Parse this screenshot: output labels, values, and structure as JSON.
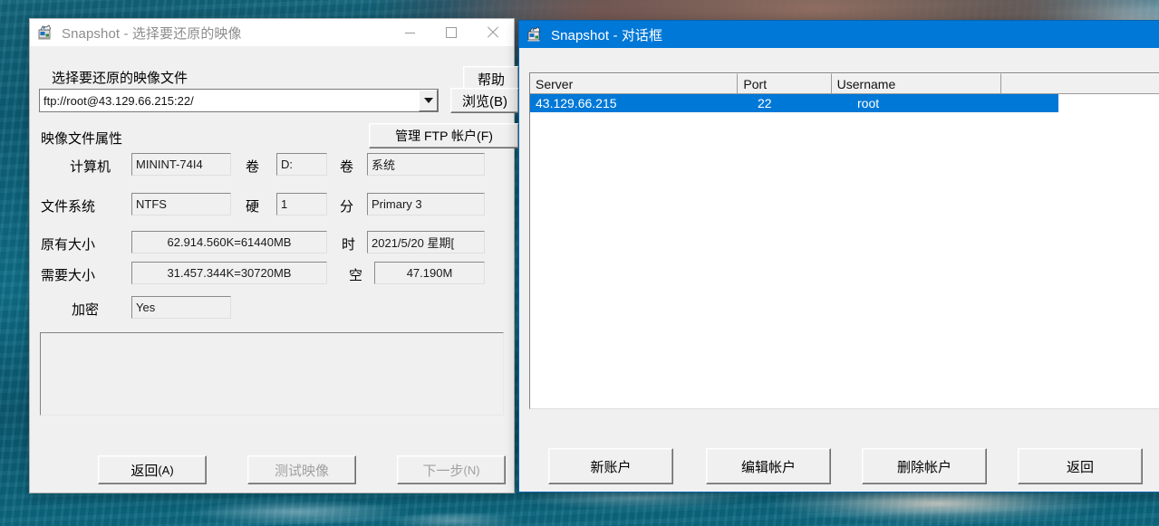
{
  "desktop": {
    "wallpaper_description": "ocean-water-cliff-wallpaper"
  },
  "restore_window": {
    "icon": "snapshot-app-icon",
    "title": "Snapshot - 选择要还原的映像",
    "active": false,
    "controls": {
      "minimize": "minimize-icon",
      "maximize": "maximize-icon",
      "close": "close-icon"
    },
    "help_button": "帮助",
    "section_label": "选择要还原的映像文件",
    "path_combo": {
      "value": "ftp://root@43.129.66.215:22/",
      "placeholder": "ftp://"
    },
    "browse_button": "浏览(B)",
    "properties_label": "映像文件属性",
    "manage_ftp_button": "管理 FTP 帐户(F)",
    "properties": [
      {
        "label": "计算机",
        "value": "MININT-74I4"
      },
      {
        "label": "卷",
        "value": "D:"
      },
      {
        "label": "卷",
        "value": "系统"
      },
      {
        "label": "文件系统",
        "value": "NTFS"
      },
      {
        "label": "硬",
        "value": "1"
      },
      {
        "label": "分",
        "value": "Primary 3"
      },
      {
        "label": "原有大小",
        "value": "62.914.560K=61440MB"
      },
      {
        "label": "时",
        "value": "2021/5/20 星期["
      },
      {
        "label": "需要大小",
        "value": "31.457.344K=30720MB"
      },
      {
        "label": "空",
        "value": "47.190M"
      },
      {
        "label": "加密",
        "value": "Yes"
      }
    ],
    "log_panel": "",
    "footer_buttons": [
      {
        "label": "返回",
        "mnemonic": "(A)",
        "enabled": true
      },
      {
        "label": "测试映像",
        "mnemonic": "",
        "enabled": false
      },
      {
        "label": "下一步",
        "mnemonic": "(N)",
        "enabled": false
      }
    ]
  },
  "dialog_window": {
    "icon": "snapshot-app-icon",
    "title": "Snapshot - 对话框",
    "active": true,
    "list": {
      "columns": [
        "Server",
        "Port",
        "Username",
        ""
      ],
      "rows": [
        {
          "server": "43.129.66.215",
          "port": "22",
          "username": "root",
          "extra": "",
          "selected": true
        }
      ]
    },
    "footer_buttons": [
      "新账户",
      "编辑帐户",
      "删除帐户",
      "返回"
    ]
  },
  "colors": {
    "accent": "#0078d7",
    "window_face": "#f0f0f0",
    "title_inactive_text": "#8d8d8d",
    "disabled_text": "#a0a0a0"
  }
}
